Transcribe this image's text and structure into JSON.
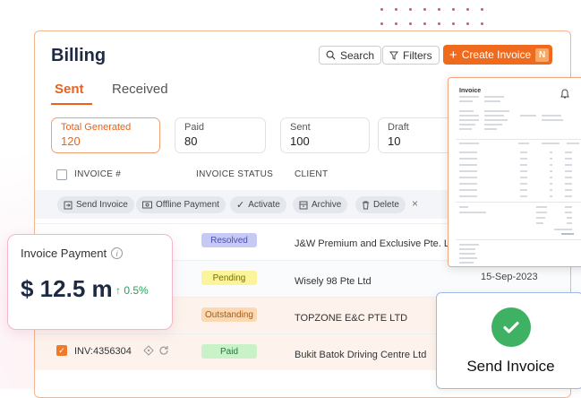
{
  "billing": {
    "title": "Billing",
    "search_label": "Search",
    "filters_label": "Filters",
    "create_label": "Create Invoice",
    "create_shortcut": "N",
    "tabs": [
      {
        "label": "Sent",
        "active": true
      },
      {
        "label": "Received",
        "active": false
      }
    ],
    "stats": [
      {
        "label": "Total Generated",
        "value": "120"
      },
      {
        "label": "Paid",
        "value": "80"
      },
      {
        "label": "Sent",
        "value": "100"
      },
      {
        "label": "Draft",
        "value": "10"
      }
    ],
    "columns": [
      "INVOICE #",
      "INVOICE STATUS",
      "CLIENT"
    ],
    "actions": [
      "Send Invoice",
      "Offline Payment",
      "Activate",
      "Archive",
      "Delete"
    ],
    "rows": [
      {
        "status": "Resolved",
        "client": "J&W Premium and Exclusive Pte. Ltd"
      },
      {
        "status": "Pending",
        "client": "Wisely 98 Pte Ltd",
        "date": "15-Sep-2023"
      },
      {
        "status": "Outstanding",
        "client": "TOPZONE E&C PTE LTD"
      },
      {
        "invoice": "INV:4356304",
        "status": "Paid",
        "client": "Bukit Batok Driving Centre Ltd"
      }
    ]
  },
  "payment_card": {
    "label": "Invoice Payment",
    "info": "i",
    "amount": "$ 12.5 m",
    "change": "0.5%"
  },
  "invoice_doc": {
    "title": "Invoice"
  },
  "send_card": {
    "label": "Send Invoice"
  },
  "colors": {
    "accent": "#f06a1e",
    "resolved": "#c7c9f5",
    "pending": "#fbf49a",
    "outstanding": "#fcd9b3",
    "paid": "#c9f2c9",
    "success": "#3fb163"
  }
}
